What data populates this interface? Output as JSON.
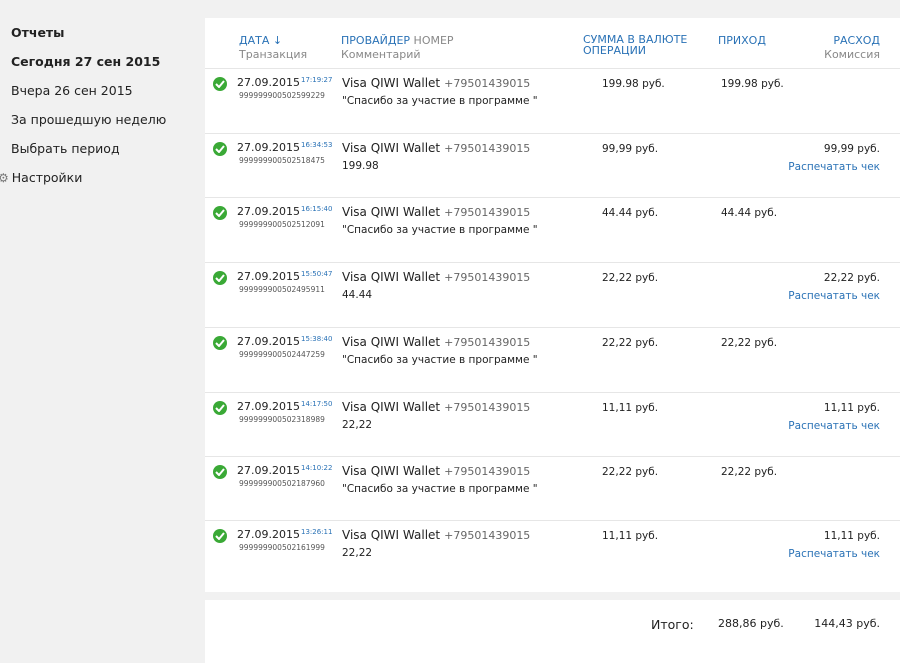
{
  "sidebar": {
    "items": [
      {
        "label": "Отчеты"
      },
      {
        "label": "Сегодня 27 сен 2015"
      },
      {
        "label": "Вчера 26 сен 2015"
      },
      {
        "label": "За прошедшую неделю"
      },
      {
        "label": "Выбрать период"
      },
      {
        "label": "Настройки"
      }
    ]
  },
  "table": {
    "headers": {
      "date": "ДАТА ↓",
      "transaction": "Транзакция",
      "provider": "ПРОВАЙДЕР",
      "number": "НОМЕР",
      "comment": "Комментарий",
      "sum": "СУММА В ВАЛЮТЕ ОПЕРАЦИИ",
      "income": "ПРИХОД",
      "expense": "РАСХОД",
      "commission": "Комиссия"
    },
    "rows": [
      {
        "date": "27.09.2015",
        "time": "17:19:27",
        "tx": "999999900502599229",
        "provider": "Visa QIWI Wallet",
        "phone": "+79501439015",
        "comment": "\"Спасибо за участие в программе \"",
        "sum": "199.98 руб.",
        "income": "199.98 руб.",
        "expense": "",
        "print": ""
      },
      {
        "date": "27.09.2015",
        "time": "16:34:53",
        "tx": "999999900502518475",
        "provider": "Visa QIWI Wallet",
        "phone": "+79501439015",
        "comment": "199.98",
        "sum": "99,99 руб.",
        "income": "",
        "expense": "99,99 руб.",
        "print": "Распечатать чек"
      },
      {
        "date": "27.09.2015",
        "time": "16:15:40",
        "tx": "999999900502512091",
        "provider": "Visa QIWI Wallet",
        "phone": "+79501439015",
        "comment": "\"Спасибо за участие в программе \"",
        "sum": "44.44 руб.",
        "income": "44.44 руб.",
        "expense": "",
        "print": ""
      },
      {
        "date": "27.09.2015",
        "time": "15:50:47",
        "tx": "999999900502495911",
        "provider": "Visa QIWI Wallet",
        "phone": "+79501439015",
        "comment": "44.44",
        "sum": "22,22 руб.",
        "income": "",
        "expense": "22,22 руб.",
        "print": "Распечатать чек"
      },
      {
        "date": "27.09.2015",
        "time": "15:38:40",
        "tx": "999999900502447259",
        "provider": "Visa QIWI Wallet",
        "phone": "+79501439015",
        "comment": "\"Спасибо за участие в программе \"",
        "sum": "22,22 руб.",
        "income": "22,22 руб.",
        "expense": "",
        "print": ""
      },
      {
        "date": "27.09.2015",
        "time": "14:17:50",
        "tx": "999999900502318989",
        "provider": "Visa QIWI Wallet",
        "phone": "+79501439015",
        "comment": "22,22",
        "sum": "11,11 руб.",
        "income": "",
        "expense": "11,11 руб.",
        "print": "Распечатать чек"
      },
      {
        "date": "27.09.2015",
        "time": "14:10:22",
        "tx": "999999900502187960",
        "provider": "Visa QIWI Wallet",
        "phone": "+79501439015",
        "comment": "\"Спасибо за участие в программе \"",
        "sum": "22,22 руб.",
        "income": "22,22 руб.",
        "expense": "",
        "print": ""
      },
      {
        "date": "27.09.2015",
        "time": "13:26:11",
        "tx": "999999900502161999",
        "provider": "Visa QIWI Wallet",
        "phone": "+79501439015",
        "comment": "22,22",
        "sum": "11,11 руб.",
        "income": "",
        "expense": "11,11 руб.",
        "print": "Распечатать чек"
      }
    ]
  },
  "footer": {
    "label": "Итого:",
    "income_total": "288,86 руб.",
    "expense_total": "144,43 руб."
  },
  "colors": {
    "accent": "#2a72b6",
    "success": "#3aa936",
    "background": "#f1f1f1"
  },
  "icons": {
    "status": "check-circle-icon",
    "settings": "gear-icon"
  }
}
